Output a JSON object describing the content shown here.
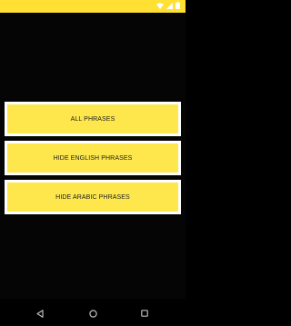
{
  "status_bar": {
    "color": "#ffe033",
    "icons": [
      "wifi-icon",
      "signal-icon",
      "battery-icon"
    ]
  },
  "buttons": {
    "all_phrases": "ALL PHRASES",
    "hide_english": "HIDE ENGLISH PHRASES",
    "hide_arabic": "HIDE ARABIC PHRASES",
    "fill_color": "#fde74c",
    "border_color": "#ffffff"
  },
  "nav_bar": {
    "icons": [
      "back-icon",
      "home-icon",
      "recents-icon"
    ]
  }
}
